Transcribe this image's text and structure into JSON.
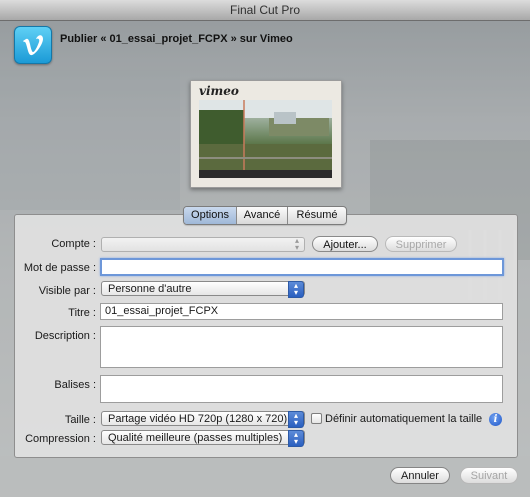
{
  "window": {
    "title": "Final Cut Pro"
  },
  "header": {
    "icon": "vimeo-icon",
    "title": "Publier « 01_essai_projet_FCPX » sur Vimeo"
  },
  "thumbnail": {
    "brand": "vimeo"
  },
  "tabs": [
    {
      "label": "Options",
      "active": true
    },
    {
      "label": "Avancé",
      "active": false
    },
    {
      "label": "Résumé",
      "active": false
    }
  ],
  "form": {
    "account": {
      "label": "Compte :",
      "value": "",
      "add_label": "Ajouter...",
      "delete_label": "Supprimer"
    },
    "password": {
      "label": "Mot de passe :",
      "value": ""
    },
    "visibility": {
      "label": "Visible par :",
      "value": "Personne d'autre"
    },
    "title": {
      "label": "Titre :",
      "value": "01_essai_projet_FCPX"
    },
    "description": {
      "label": "Description :",
      "value": ""
    },
    "tags": {
      "label": "Balises :",
      "value": ""
    },
    "size": {
      "label": "Taille :",
      "value": "Partage vidéo HD 720p (1280 x 720)",
      "auto_label": "Définir automatiquement la taille",
      "auto_checked": false
    },
    "compression": {
      "label": "Compression :",
      "value": "Qualité meilleure (passes multiples)"
    }
  },
  "footer": {
    "cancel_label": "Annuler",
    "next_label": "Suivant"
  },
  "colors": {
    "accent": "#2a5fbf",
    "vimeo": "#1ab7ea"
  }
}
